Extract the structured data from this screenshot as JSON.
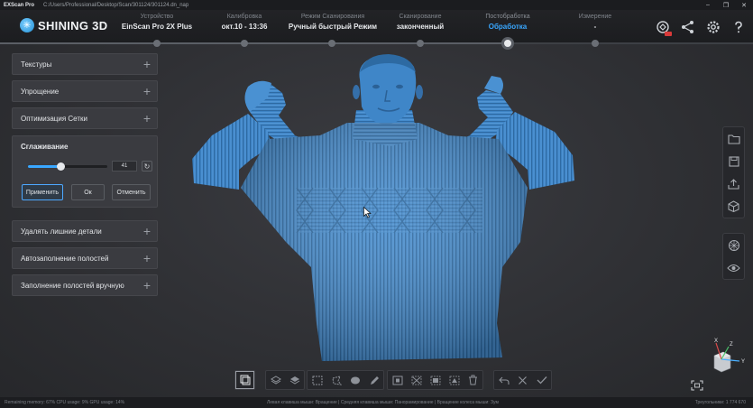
{
  "titlebar": {
    "app_name": "EXScan Pro",
    "path": "C:/Users/Professional/Desktop/Scan/301124/301124.dn_nap",
    "min": "–",
    "restore": "❐",
    "close": "✕"
  },
  "header": {
    "logo_text": "SHINING 3D",
    "steps": [
      {
        "label": "Устройство",
        "value": "EinScan Pro 2X Plus"
      },
      {
        "label": "Калибровка",
        "value": "окт.10 - 13:36"
      },
      {
        "label": "Режим Сканирования",
        "value": "Ручный быстрый Режим"
      },
      {
        "label": "Сканирование",
        "value": "законченный"
      },
      {
        "label": "Постобработка",
        "value": "Обработка"
      },
      {
        "label": "Измерение",
        "value": "-"
      }
    ],
    "icons": [
      "mesh-upload-icon",
      "share-icon",
      "settings-icon",
      "help-icon"
    ]
  },
  "left_panel": {
    "sections": [
      {
        "title": "Текстуры",
        "expand": "+"
      },
      {
        "title": "Упрощение",
        "expand": "+"
      },
      {
        "title": "Оптимизация Сетки",
        "expand": "+"
      }
    ],
    "smoothing": {
      "title": "Сглаживание",
      "slider_fraction": 0.41,
      "value": "41",
      "reset_icon": "↻",
      "apply": "Применить",
      "ok": "Ок",
      "cancel": "Отменить"
    },
    "sections_bottom": [
      {
        "title": "Удалять лишние детали",
        "expand": "+"
      },
      {
        "title": "Автозаполнение полостей",
        "expand": "+"
      },
      {
        "title": "Заполнение полостей вручную",
        "expand": "+"
      }
    ]
  },
  "right_toolbar": {
    "group1": [
      "open-folder-icon",
      "save-icon",
      "export-icon",
      "model-cube-icon"
    ],
    "group2": [
      "mesh-view-icon",
      "visibility-icon"
    ]
  },
  "bottom_toolbar": {
    "groups": [
      [
        "select-all-icon"
      ],
      [
        "layer-front-icon",
        "layer-back-icon"
      ],
      [
        "rect-select-icon",
        "lasso-select-icon",
        "brush-select-icon",
        "pen-select-icon"
      ],
      [
        "invert-select-icon",
        "deselect-icon",
        "crop-select-icon",
        "fill-select-icon",
        "delete-select-icon"
      ],
      [
        "undo-icon",
        "cancel-icon",
        "confirm-icon"
      ]
    ]
  },
  "status": {
    "left": "Remaining memory: 67%   CPU usage: 9%   GPU usage: 14%",
    "middle": "Левая клавиша мыши: Вращение | Средняя клавиша мыши: Панорамирование | Вращение колеса мыши: Зум",
    "right": "Треугольники: 1 774 670"
  },
  "gizmo": {
    "x": "X",
    "y": "Y",
    "z": "Z"
  },
  "colors": {
    "accent": "#39a7ff",
    "model": "#3f86c8",
    "background": "#2e2f33"
  }
}
